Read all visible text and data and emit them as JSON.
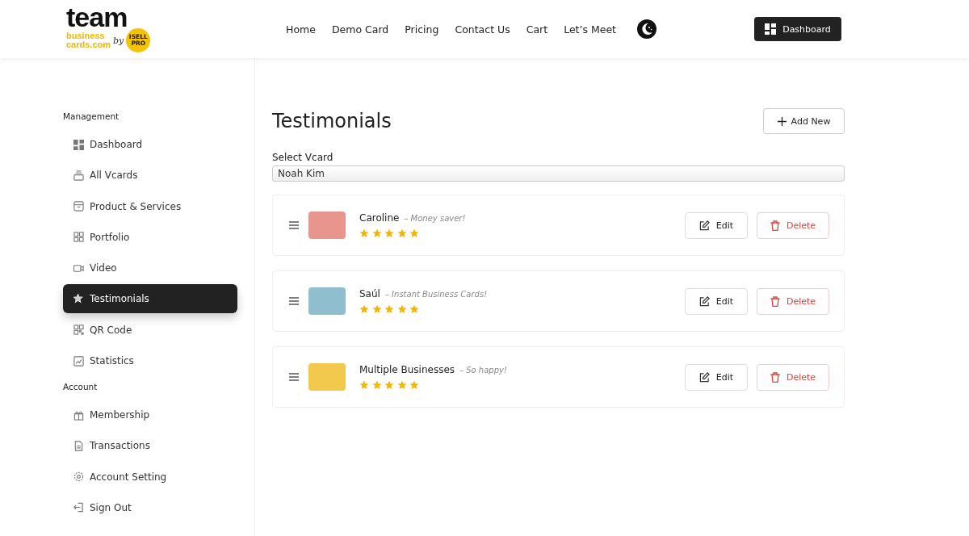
{
  "logo": {
    "wordmark": "team",
    "line_1": "business",
    "line_2": "cards.com",
    "by": "by",
    "badge_top": "ISELL",
    "badge_bottom": "PRO"
  },
  "nav": [
    {
      "label": "Home"
    },
    {
      "label": "Demo Card"
    },
    {
      "label": "Pricing"
    },
    {
      "label": "Contact Us"
    },
    {
      "label": "Cart"
    },
    {
      "label": "Let’s Meet"
    }
  ],
  "header_button": "Dashboard",
  "sidebar": [
    {
      "heading": "Management",
      "items": [
        {
          "label": "Dashboard",
          "kind": "grid",
          "selected": false
        },
        {
          "label": "All Vcards",
          "kind": "stack",
          "selected": false
        },
        {
          "label": "Product & Services",
          "kind": "box",
          "selected": false
        },
        {
          "label": "Portfolio",
          "kind": "squares",
          "selected": false
        },
        {
          "label": "Video",
          "kind": "video",
          "selected": false
        },
        {
          "label": "Testimonials",
          "kind": "star",
          "selected": true
        },
        {
          "label": "QR Code",
          "kind": "qr",
          "selected": false
        },
        {
          "label": "Statistics",
          "kind": "chart",
          "selected": false
        }
      ]
    },
    {
      "heading": "Account",
      "items": [
        {
          "label": "Membership",
          "kind": "gift",
          "selected": false
        },
        {
          "label": "Transactions",
          "kind": "doc",
          "selected": false
        },
        {
          "label": "Account Setting",
          "kind": "gear",
          "selected": false
        },
        {
          "label": "Sign Out",
          "kind": "signout",
          "selected": false
        }
      ]
    }
  ],
  "page_title": "Testimonials",
  "add_button": "Add New",
  "select": {
    "label": "Select Vcard",
    "value": "Noah Kim"
  },
  "testimonials": [
    {
      "name": "Caroline",
      "quote": "– Money saver!",
      "stars": 5,
      "color": "#e8958e",
      "edit": "Edit",
      "delete": "Delete"
    },
    {
      "name": "Saúl",
      "quote": "– Instant Business Cards!",
      "stars": 5,
      "color": "#8fbfcf",
      "edit": "Edit",
      "delete": "Delete"
    },
    {
      "name": "Multiple Businesses",
      "quote": "– So happy!",
      "stars": 5,
      "color": "#f2c94c",
      "edit": "Edit",
      "delete": "Delete"
    }
  ]
}
